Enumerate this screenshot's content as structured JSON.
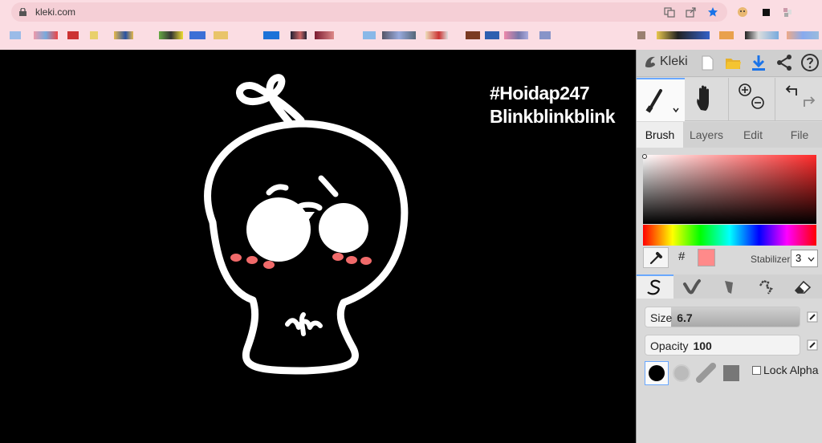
{
  "browser": {
    "url": "kleki.com"
  },
  "canvas": {
    "caption_line1": "#Hoidap247",
    "caption_line2": "Blinkblinkblink"
  },
  "app": {
    "logo_text": "Kleki",
    "tabs": [
      "Brush",
      "Layers",
      "Edit",
      "File"
    ],
    "active_tab": "Brush",
    "color": {
      "hash_label": "#",
      "current": "#ff8a8a",
      "stabilizer_label": "Stabilizer",
      "stabilizer_value": "3"
    },
    "size": {
      "label": "Size",
      "value": "6.7",
      "fill_fraction": 0.15
    },
    "opacity": {
      "label": "Opacity",
      "value": "100",
      "fill_fraction": 0.0
    },
    "lock_alpha_label": "Lock Alpha"
  }
}
